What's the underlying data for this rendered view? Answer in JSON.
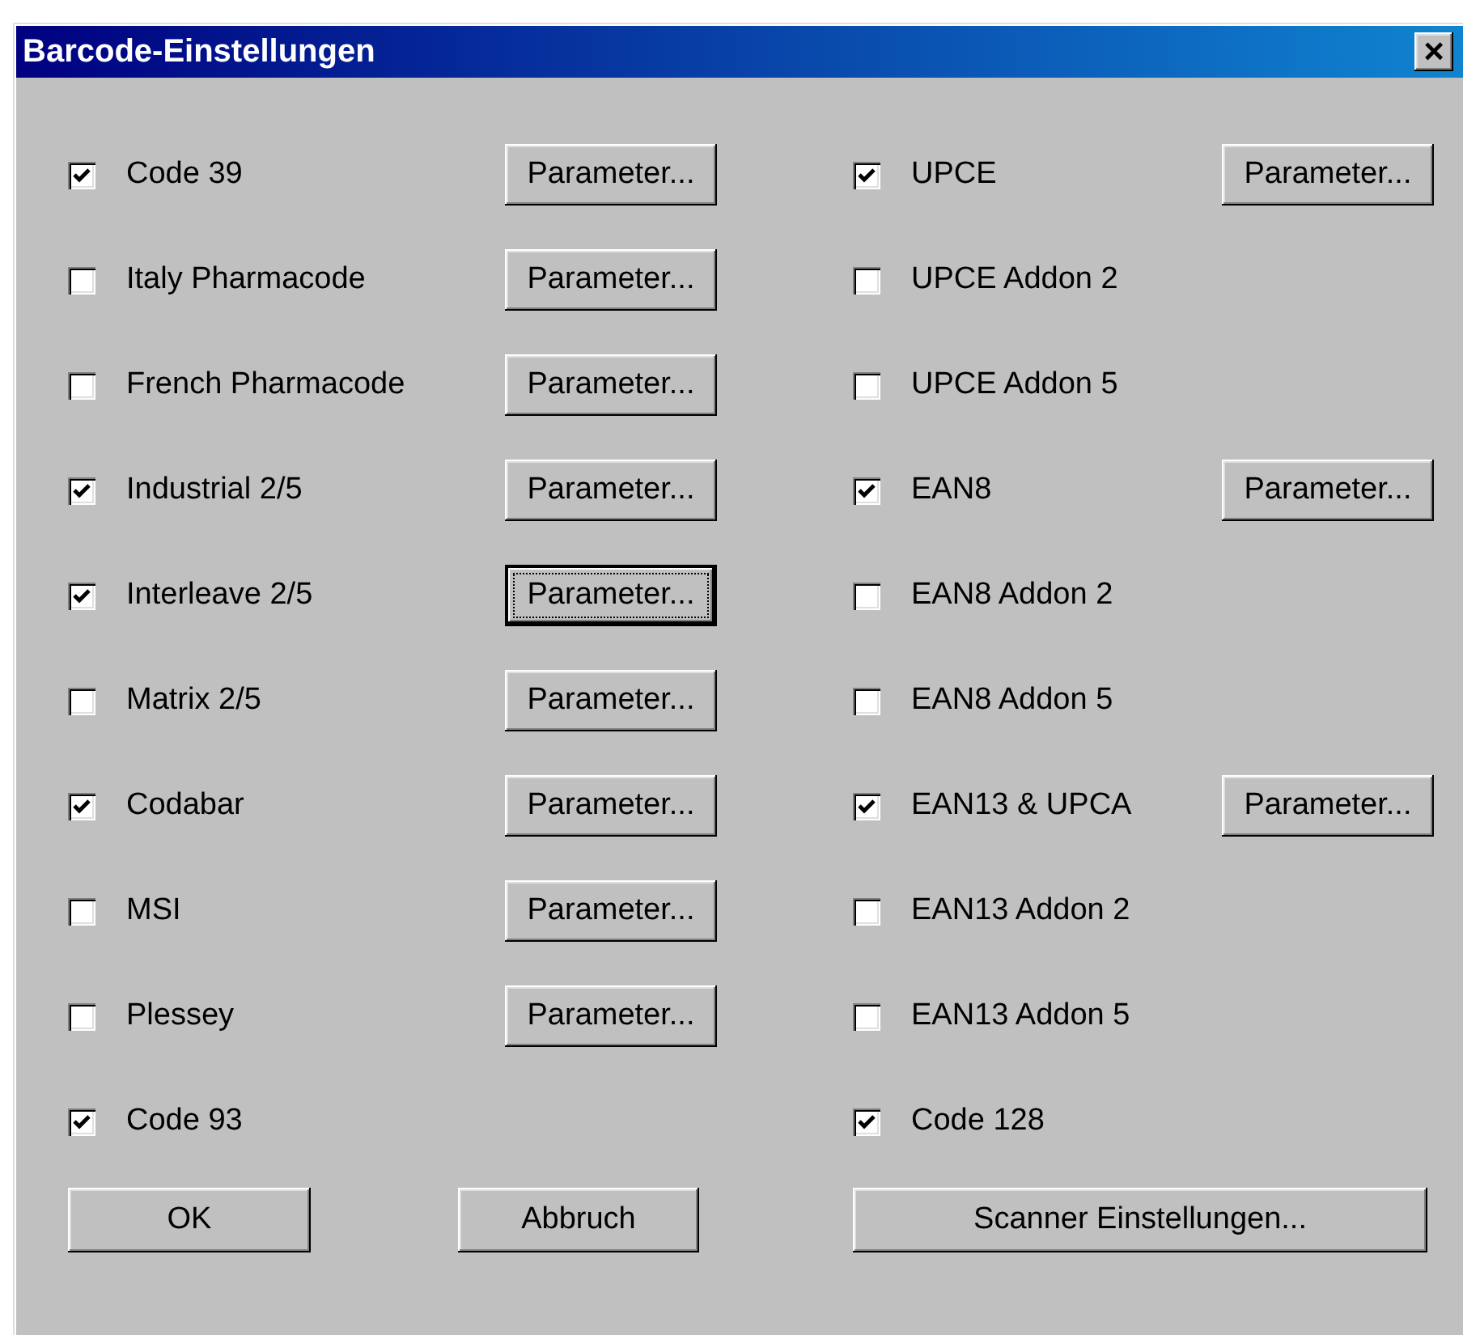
{
  "window": {
    "title": "Barcode-Einstellungen",
    "close": "×"
  },
  "left_column": [
    {
      "label": "Code 39",
      "checked": true,
      "button": "Parameter...",
      "focused": false
    },
    {
      "label": "Italy Pharmacode",
      "checked": false,
      "button": "Parameter...",
      "focused": false
    },
    {
      "label": "French Pharmacode",
      "checked": false,
      "button": "Parameter...",
      "focused": false
    },
    {
      "label": "Industrial 2/5",
      "checked": true,
      "button": "Parameter...",
      "focused": false
    },
    {
      "label": "Interleave 2/5",
      "checked": true,
      "button": "Parameter...",
      "focused": true
    },
    {
      "label": "Matrix 2/5",
      "checked": false,
      "button": "Parameter...",
      "focused": false
    },
    {
      "label": "Codabar",
      "checked": true,
      "button": "Parameter...",
      "focused": false
    },
    {
      "label": "MSI",
      "checked": false,
      "button": "Parameter...",
      "focused": false
    },
    {
      "label": "Plessey",
      "checked": false,
      "button": "Parameter...",
      "focused": false
    },
    {
      "label": "Code 93",
      "checked": true
    }
  ],
  "right_column": [
    {
      "label": "UPCE",
      "checked": true,
      "button": "Parameter...",
      "focused": false
    },
    {
      "label": "UPCE Addon 2",
      "checked": false
    },
    {
      "label": "UPCE Addon 5",
      "checked": false
    },
    {
      "label": "EAN8",
      "checked": true,
      "button": "Parameter...",
      "focused": false
    },
    {
      "label": "EAN8 Addon 2",
      "checked": false
    },
    {
      "label": "EAN8 Addon 5",
      "checked": false
    },
    {
      "label": "EAN13 & UPCA",
      "checked": true,
      "button": "Parameter...",
      "focused": false
    },
    {
      "label": "EAN13 Addon 2",
      "checked": false
    },
    {
      "label": "EAN13 Addon 5",
      "checked": false
    },
    {
      "label": "Code 128",
      "checked": true
    }
  ],
  "buttons": [
    {
      "label": "OK",
      "kind": "ok"
    },
    {
      "label": "Abbruch",
      "kind": "cancel"
    },
    {
      "label": "Scanner Einstellungen...",
      "kind": "scanner"
    }
  ]
}
